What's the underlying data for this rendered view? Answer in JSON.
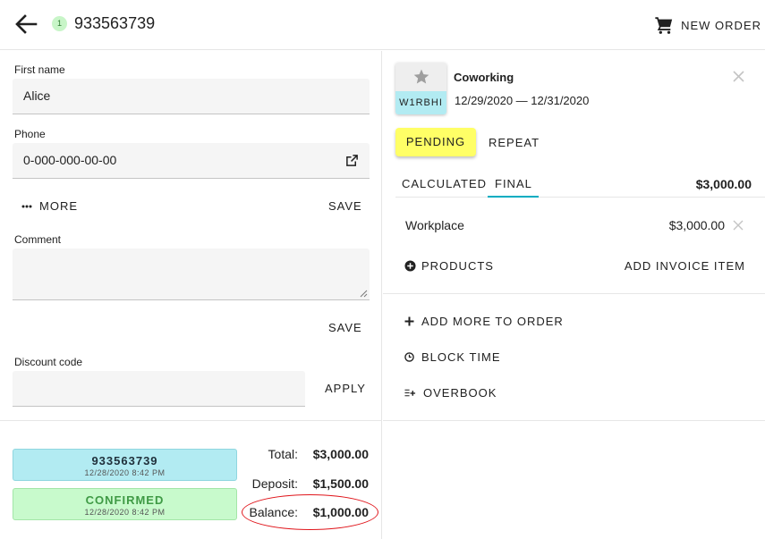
{
  "header": {
    "badge_count": "1",
    "order_number": "933563739",
    "new_order_label": "NEW ORDER"
  },
  "form": {
    "first_name_label": "First name",
    "first_name_value": "Alice",
    "phone_label": "Phone",
    "phone_value": "0-000-000-00-00",
    "more_label": "MORE",
    "save_label": "SAVE",
    "comment_label": "Comment",
    "comment_value": "",
    "comment_save_label": "SAVE",
    "discount_label": "Discount code",
    "discount_value": "",
    "apply_label": "APPLY"
  },
  "status_cards": [
    {
      "main": "933563739",
      "sub": "12/28/2020 8:42 PM",
      "color": "#b2ebf2"
    },
    {
      "main": "CONFIRMED",
      "sub": "12/28/2020 8:42 PM",
      "color": "#c8facc"
    }
  ],
  "totals": {
    "total_label": "Total:",
    "total_value": "$3,000.00",
    "deposit_label": "Deposit:",
    "deposit_value": "$1,500.00",
    "balance_label": "Balance:",
    "balance_value": "$1,000.00",
    "highlight_color": "#e0151b"
  },
  "booking": {
    "space_name": "Coworking",
    "space_code": "W1RBHI",
    "dates": "12/29/2020 — 12/31/2020",
    "status_label": "PENDING",
    "status_color": "#ffff66",
    "repeat_label": "REPEAT"
  },
  "tabs": {
    "calculated_label": "CALCULATED",
    "final_label": "FINAL",
    "active": "FINAL",
    "total": "$3,000.00"
  },
  "line_items": [
    {
      "name": "Workplace",
      "price": "$3,000.00"
    }
  ],
  "actions": {
    "products_label": "PRODUCTS",
    "add_invoice_label": "ADD INVOICE ITEM",
    "add_more_label": "ADD MORE TO ORDER",
    "block_time_label": "BLOCK TIME",
    "overbook_label": "OVERBOOK"
  },
  "icons": [
    "arrow-back-icon",
    "cart-icon",
    "external-link-icon",
    "more-dots-icon",
    "star-icon",
    "close-icon",
    "add-circle-icon",
    "plus-icon",
    "clock-icon",
    "overbook-icon"
  ]
}
